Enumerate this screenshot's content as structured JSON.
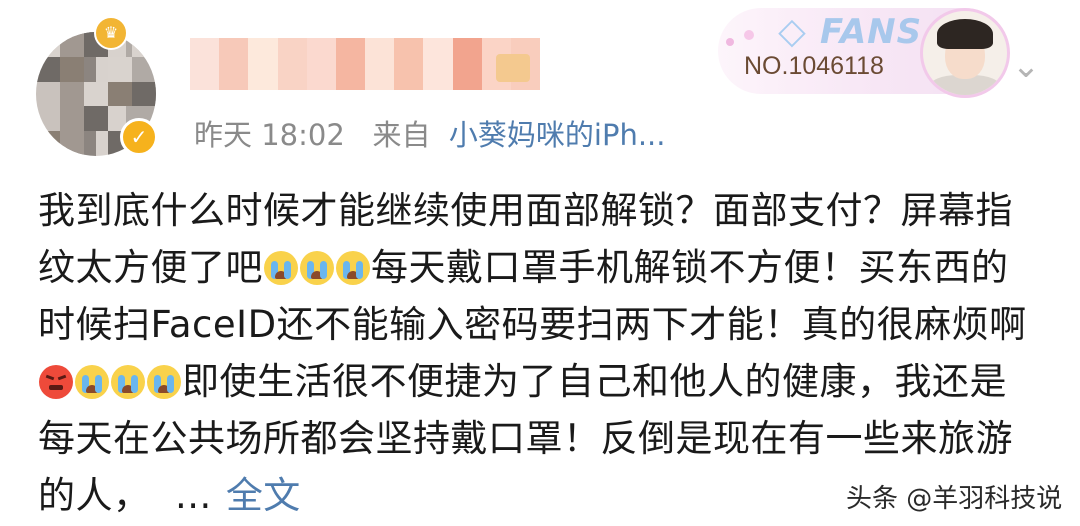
{
  "post_header": {
    "time": "昨天 18:02",
    "source_prefix": "来自",
    "source": "小葵妈咪的iPh..."
  },
  "fans_badge": {
    "label": "FANS",
    "number": "NO.1046118"
  },
  "post_body": {
    "line1": "我到底什么时候才能继续使用面部解锁？面部支付？屏幕指",
    "line2_a": "纹太方便了吧",
    "line2_b": "每天戴口罩手机解锁不方便！买东西的",
    "line3": "时候扫FaceID还不能输入密码要扫两下才能！真的很麻烦啊",
    "line4": "即使生活很不便捷为了自己和他人的健康，我还是",
    "line5": "每天在公共场所都会坚持戴口罩！反倒是现在有一些来旅游",
    "line6": "的人，  ...",
    "full_text_link": "全文"
  },
  "watermark": "头条 @羊羽科技说",
  "colors": {
    "link": "#4f7cae",
    "meta": "#8a8a8a",
    "verified": "#f6b21d"
  },
  "icons": [
    "verified-icon",
    "crown-icon",
    "diamond-icon",
    "chevron-down-icon",
    "crying-emoji",
    "angry-emoji"
  ]
}
